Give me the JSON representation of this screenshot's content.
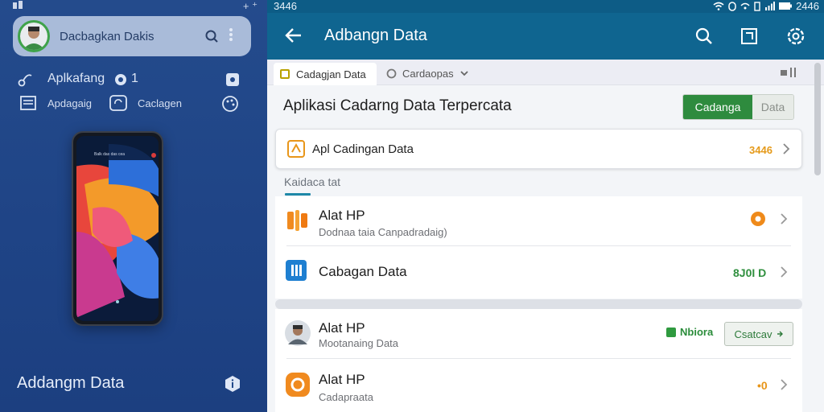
{
  "left": {
    "account_name": "Dacbagkan Dakis",
    "row1_label": "Aplkafang",
    "row1_count": "1",
    "row2_item1": "Apdagaig",
    "row2_item2": "Caclagen",
    "phone_status_text": "Balk das das cea",
    "bottom_title": "Addangm Data"
  },
  "right": {
    "status": {
      "time": "3446",
      "right_time": "2446"
    },
    "appbar": {
      "title": "Adbangn Data"
    },
    "tabs": [
      {
        "label": "Cadagjan Data"
      },
      {
        "label": "Cardaopas"
      }
    ],
    "heading": "Aplikasi Cadarng Data Terpercata",
    "segment": {
      "on": "Cadanga",
      "off": "Data"
    },
    "card": {
      "label": "Apl Cadingan Data",
      "value": "3446"
    },
    "section_label": "Kaidaca tat",
    "list": [
      {
        "title": "Alat HP",
        "subtitle": "Dodnaa taia Canpadradaig)",
        "value": "",
        "value_color": "#e8961a"
      },
      {
        "title": "Cabagan Data",
        "subtitle": "",
        "value": "8J0I D",
        "value_color": "#2f8f3e"
      },
      {
        "title": "Alat HP",
        "subtitle": "Mootanaing Data",
        "badge": "Nbiora",
        "button": "Csatcav"
      },
      {
        "title": "Alat HP",
        "subtitle": "Cadapraata",
        "value": "•0",
        "value_color": "#e8961a"
      }
    ]
  },
  "colors": {
    "left_bg": "#1f4486",
    "appbar": "#0f6590",
    "accent_green": "#2e8b3e",
    "accent_orange": "#e8961a"
  }
}
